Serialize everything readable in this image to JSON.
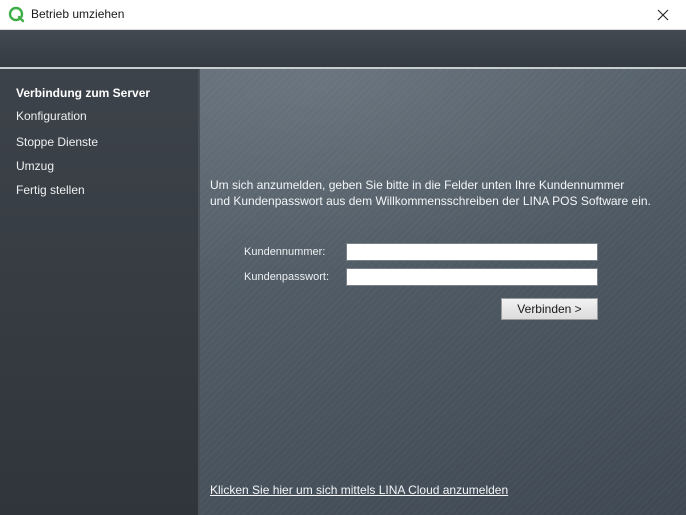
{
  "window": {
    "title": "Betrieb umziehen"
  },
  "sidebar": {
    "items": [
      {
        "label": "Verbindung zum Server",
        "active": true
      },
      {
        "label": "Konfiguration",
        "active": false
      },
      {
        "label": "Stoppe Dienste",
        "active": false
      },
      {
        "label": "Umzug",
        "active": false
      },
      {
        "label": "Fertig stellen",
        "active": false
      }
    ]
  },
  "main": {
    "instruction_line1": "Um sich anzumelden, geben Sie bitte in die Felder unten Ihre Kundennummer",
    "instruction_line2": "und Kundenpasswort aus dem Willkommensschreiben der LINA POS Software ein.",
    "customer_number": {
      "label": "Kundennummer:",
      "value": ""
    },
    "customer_password": {
      "label": "Kundenpasswort:",
      "value": ""
    },
    "connect_label": "Verbinden >",
    "cloud_link": "Klicken Sie hier um sich mittels LINA Cloud anzumelden"
  },
  "colors": {
    "app_icon": "#3fae49",
    "sidebar_bg": "#3a4047",
    "content_bg": "#56616b"
  },
  "icons": {
    "app": "app-logo-icon",
    "close": "close-icon"
  }
}
